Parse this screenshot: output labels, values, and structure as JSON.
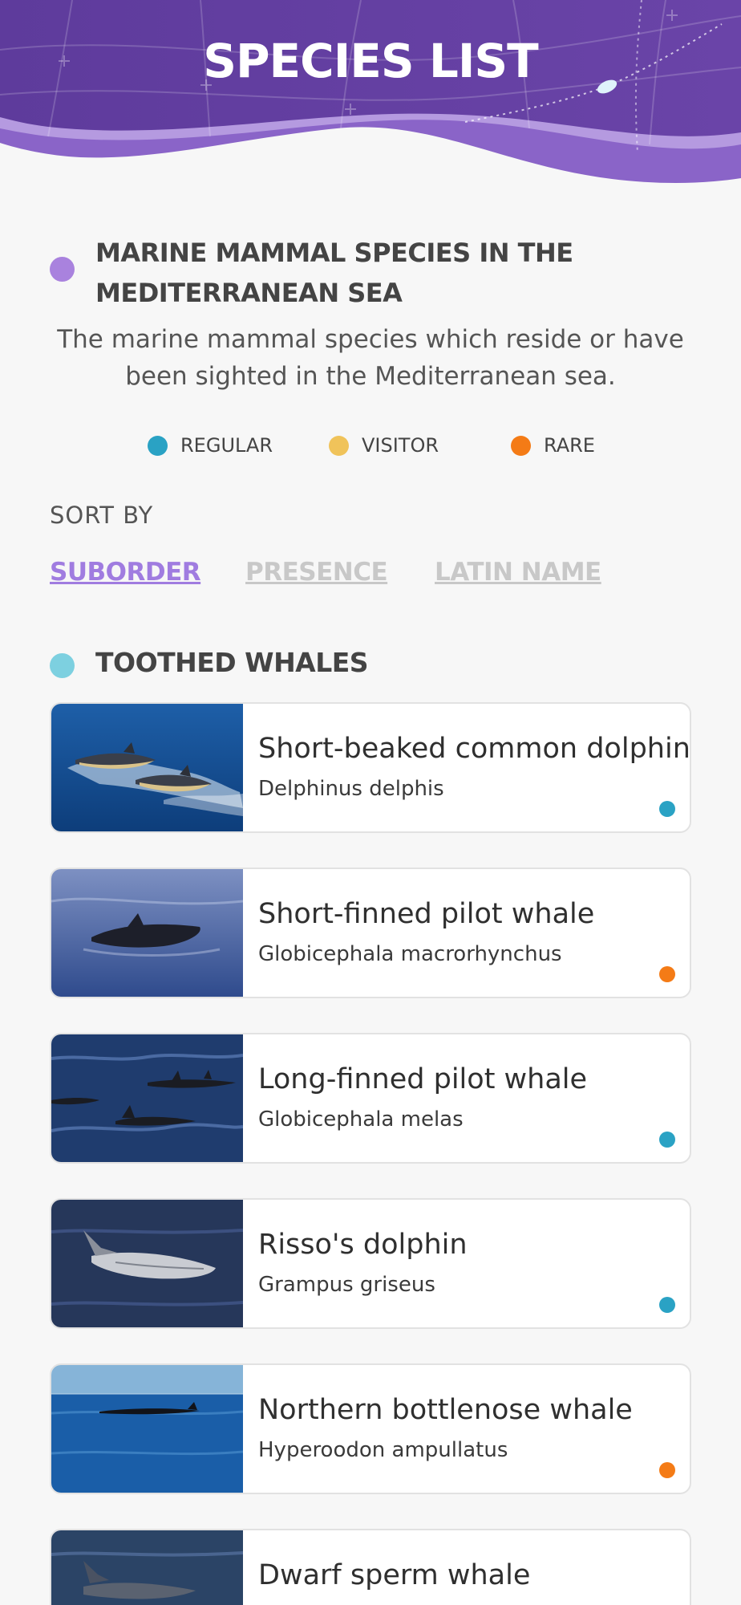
{
  "header": {
    "title": "SPECIES LIST"
  },
  "section": {
    "title_line1": "MARINE MAMMAL SPECIES IN THE",
    "title_line2": "MEDITERRANEAN SEA",
    "description_line1": "The marine mammal species which reside or have",
    "description_line2": "been sighted in the Mediterranean sea."
  },
  "legend": [
    {
      "label": "REGULAR",
      "color": "#2aa2c4"
    },
    {
      "label": "VISITOR",
      "color": "#f0c35a"
    },
    {
      "label": "RARE",
      "color": "#f47b16"
    }
  ],
  "sort": {
    "label": "SORT BY",
    "options": [
      {
        "label": "SUBORDER",
        "active": true
      },
      {
        "label": "PRESENCE",
        "active": false
      },
      {
        "label": "LATIN NAME",
        "active": false
      }
    ]
  },
  "group": {
    "title": "TOOTHED WHALES"
  },
  "species": [
    {
      "name": "Short-beaked common dolphin",
      "latin": "Delphinus delphis",
      "presence": "regular",
      "color": "#2aa2c4"
    },
    {
      "name": "Short-finned pilot whale",
      "latin": "Globicephala macrorhynchus",
      "presence": "rare",
      "color": "#f47b16"
    },
    {
      "name": "Long-finned pilot whale",
      "latin": "Globicephala melas",
      "presence": "regular",
      "color": "#2aa2c4"
    },
    {
      "name": "Risso's dolphin",
      "latin": "Grampus griseus",
      "presence": "regular",
      "color": "#2aa2c4"
    },
    {
      "name": "Northern bottlenose whale",
      "latin": "Hyperoodon ampullatus",
      "presence": "rare",
      "color": "#f47b16"
    },
    {
      "name": "Dwarf sperm whale",
      "latin": "",
      "presence": "",
      "color": ""
    }
  ]
}
